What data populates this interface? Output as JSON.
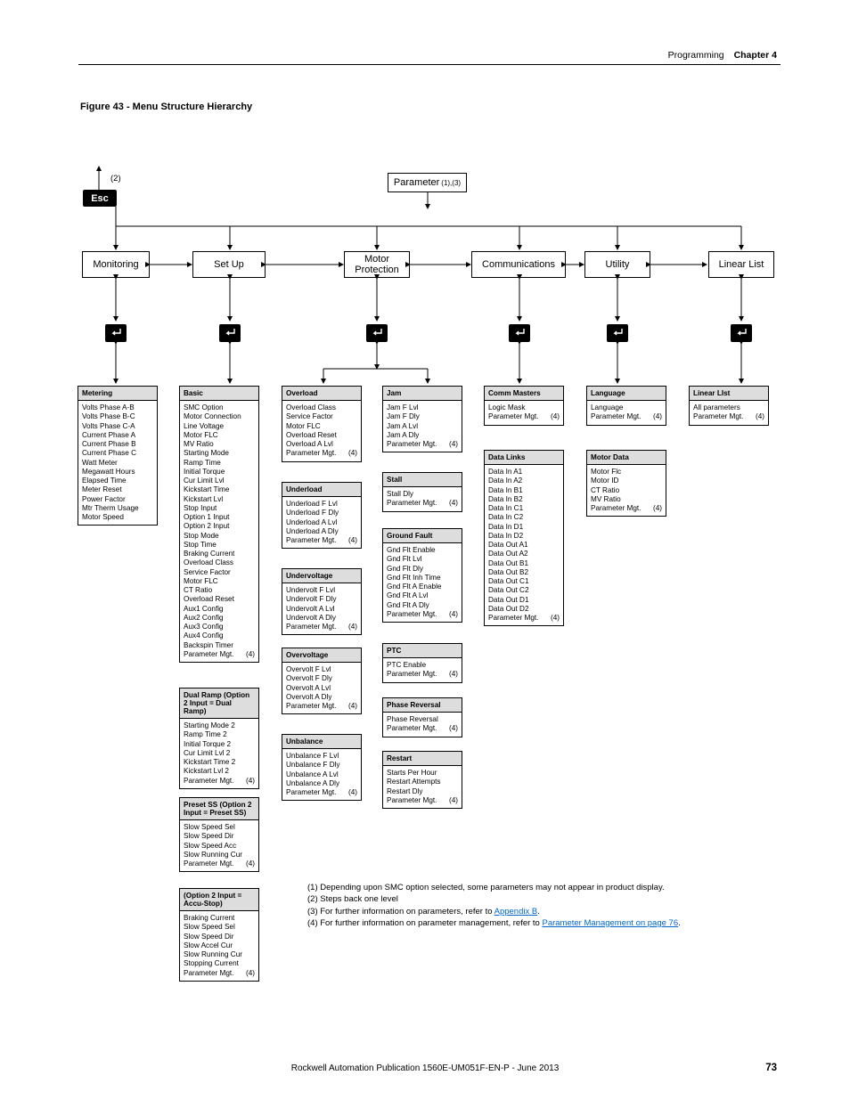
{
  "header": {
    "section": "Programming",
    "chapter": "Chapter 4"
  },
  "figure_title": "Figure 43 - Menu Structure Hierarchy",
  "top_annot": "(2)",
  "esc_label": "Esc",
  "param_label": "Parameter",
  "param_sup": "(1),(3)",
  "menus": {
    "monitoring": "Monitoring",
    "setup": "Set Up",
    "motorprot": "Motor Protection",
    "comms": "Communications",
    "utility": "Utility",
    "linear": "Linear List"
  },
  "metering": {
    "head": "Metering",
    "items": [
      "Volts Phase A-B",
      "Volts Phase B-C",
      "Volts Phase C-A",
      "Current Phase A",
      "Current Phase B",
      "Current Phase C",
      "Watt Meter",
      "Megawatt Hours",
      "Elapsed Time",
      "Meter Reset",
      "Power Factor",
      "Mtr Therm Usage",
      "Motor Speed"
    ]
  },
  "basic": {
    "head": "Basic",
    "items": [
      "SMC Option",
      "Motor Connection",
      "Line Voltage",
      "Motor FLC",
      "MV Ratio",
      "Starting Mode",
      "Ramp Time",
      "Initial Torque",
      "Cur Limit Lvl",
      "Kickstart Time",
      "Kickstart Lvl",
      "Stop Input",
      "Option 1 Input",
      "Option 2 Input",
      "Stop Mode",
      "Stop Time",
      "Braking Current",
      "Overload Class",
      "Service Factor",
      "Motor FLC",
      "CT Ratio",
      "Overload Reset",
      "Aux1 Config",
      "Aux2 Config",
      "Aux3 Config",
      "Aux4 Config",
      "Backspin Timer"
    ],
    "pm": "Parameter Mgt.",
    "four": "(4)"
  },
  "dualramp": {
    "head": "Dual Ramp (Option 2 Input = Dual Ramp)",
    "items": [
      "Starting Mode 2",
      "Ramp Time 2",
      "Initial Torque 2",
      "Cur Limit Lvl 2",
      "Kickstart Time 2",
      "Kickstart Lvl 2"
    ],
    "pm": "Parameter Mgt.",
    "four": "(4)"
  },
  "presetss": {
    "head": "Preset SS (Option 2 Input = Preset SS)",
    "items": [
      "Slow Speed Sel",
      "Slow Speed Dir",
      "Slow Speed Acc",
      "Slow Running Cur"
    ],
    "pm": "Parameter Mgt.",
    "four": "(4)"
  },
  "accustop": {
    "head": "(Option 2 Input = Accu-Stop)",
    "items": [
      "Braking Current",
      "Slow Speed Sel",
      "Slow Speed Dir",
      "Slow Accel Cur",
      "Slow Running Cur",
      "Stopping Current"
    ],
    "pm": "Parameter Mgt.",
    "four": "(4)"
  },
  "overload": {
    "head": "Overload",
    "items": [
      "Overload Class",
      "Service Factor",
      "Motor FLC",
      "Overload Reset",
      "Overload A Lvl"
    ],
    "pm": "Parameter Mgt.",
    "four": "(4)"
  },
  "underload": {
    "head": "Underload",
    "items": [
      "Underload F Lvl",
      "Underload F Dly",
      "Underload A Lvl",
      "Underload A Dly"
    ],
    "pm": "Parameter Mgt.",
    "four": "(4)"
  },
  "undervolt": {
    "head": "Undervoltage",
    "items": [
      "Undervolt F Lvl",
      "Undervolt F Dly",
      "Undervolt A Lvl",
      "Undervolt A Dly"
    ],
    "pm": "Parameter Mgt.",
    "four": "(4)"
  },
  "overvolt": {
    "head": "Overvoltage",
    "items": [
      "Overvolt F Lvl",
      "Overvolt F Dly",
      "Overvolt A Lvl",
      "Overvolt A Dly"
    ],
    "pm": "Parameter Mgt.",
    "four": "(4)"
  },
  "unbalance": {
    "head": "Unbalance",
    "items": [
      "Unbalance F Lvl",
      "Unbalance F Dly",
      "Unbalance A Lvl",
      "Unbalance A Dly"
    ],
    "pm": "Parameter Mgt.",
    "four": "(4)"
  },
  "jam": {
    "head": "Jam",
    "items": [
      "Jam F Lvl",
      "Jam F Dly",
      "Jam A Lvl",
      "Jam A Dly"
    ],
    "pm": "Parameter Mgt.",
    "four": "(4)"
  },
  "stall": {
    "head": "Stall",
    "items": [
      "Stall Dly"
    ],
    "pm": "Parameter Mgt.",
    "four": "(4)"
  },
  "gndfault": {
    "head": "Ground Fault",
    "items": [
      "Gnd Flt Enable",
      "Gnd Flt Lvl",
      "Gnd Flt Dly",
      "Gnd Flt Inh Time",
      "Gnd Flt A Enable",
      "Gnd Flt A Lvl",
      "Gnd Flt A Dly"
    ],
    "pm": "Parameter Mgt.",
    "four": "(4)"
  },
  "ptc": {
    "head": "PTC",
    "items": [
      "PTC Enable"
    ],
    "pm": "Parameter Mgt.",
    "four": "(4)"
  },
  "phaserev": {
    "head": "Phase Reversal",
    "items": [
      "Phase Reversal"
    ],
    "pm": "Parameter Mgt.",
    "four": "(4)"
  },
  "restart": {
    "head": "Restart",
    "items": [
      "Starts Per Hour",
      "Restart Attempts",
      "Restart Dly"
    ],
    "pm": "Parameter Mgt.",
    "four": "(4)"
  },
  "commmasters": {
    "head": "Comm Masters",
    "items": [
      "Logic Mask"
    ],
    "pm": "Parameter Mgt.",
    "four": "(4)"
  },
  "datalinks": {
    "head": "Data Links",
    "items": [
      "Data In A1",
      "Data In A2",
      "Data In B1",
      "Data In B2",
      "Data In C1",
      "Data In C2",
      "Data In D1",
      "Data In D2",
      "Data Out A1",
      "Data Out A2",
      "Data Out B1",
      "Data Out B2",
      "Data Out C1",
      "Data Out C2",
      "Data Out D1",
      "Data Out D2"
    ],
    "pm": "Parameter Mgt.",
    "four": "(4)"
  },
  "language": {
    "head": "Language",
    "items": [
      "Language"
    ],
    "pm": "Parameter Mgt.",
    "four": "(4)"
  },
  "motordata": {
    "head": "Motor Data",
    "items": [
      "Motor Flc",
      "Motor ID",
      "CT Ratio",
      "MV Ratio"
    ],
    "pm": "Parameter Mgt.",
    "four": "(4)"
  },
  "linearlist": {
    "head": "Linear LIst",
    "items": [
      "All parameters"
    ],
    "pm": "Parameter Mgt.",
    "four": "(4)"
  },
  "notes": {
    "n1": "(1) Depending upon SMC option selected, some parameters may not appear in product display.",
    "n2": "(2) Steps back one level",
    "n3a": "(3) For further information on parameters, refer to ",
    "n3b": "Appendix B",
    "n3c": ".",
    "n4a": "(4) For further information on parameter management, refer to ",
    "n4b": "Parameter Management on page 76",
    "n4c": "."
  },
  "footer": "Rockwell Automation Publication 1560E-UM051F-EN-P - June 2013",
  "pagenum": "73"
}
